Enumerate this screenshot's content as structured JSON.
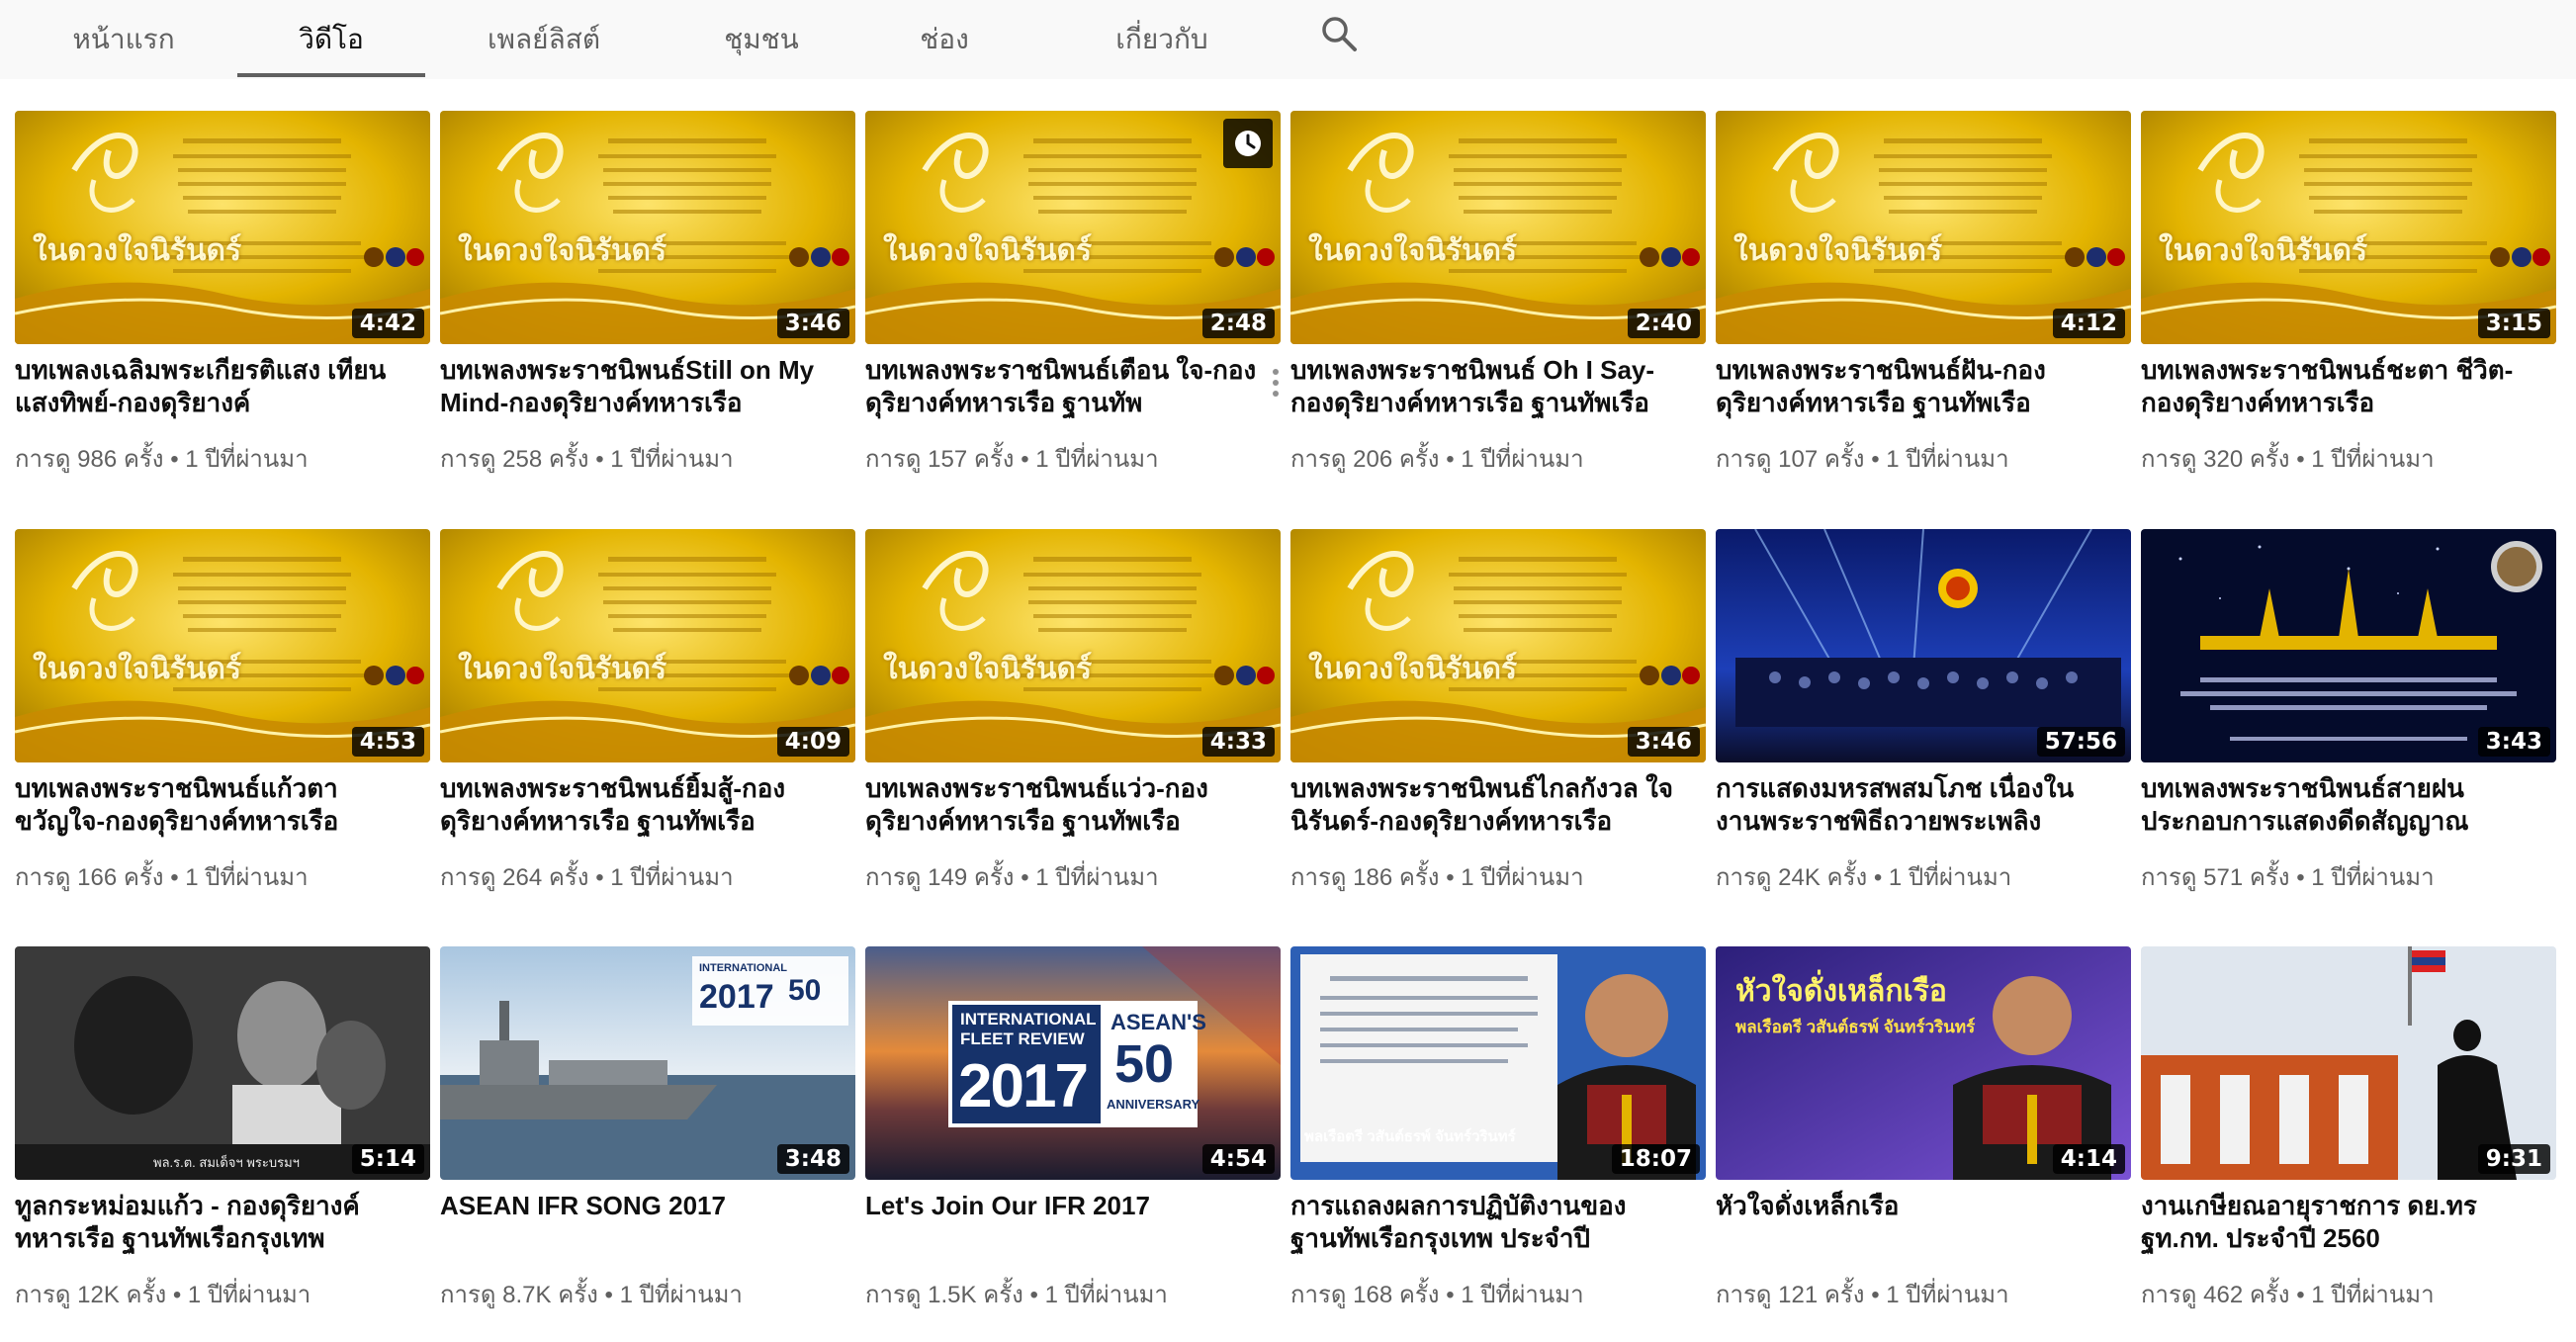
{
  "tabs": [
    {
      "label": "หน้าแรก"
    },
    {
      "label": "วิดีโอ"
    },
    {
      "label": "เพลย์ลิสต์"
    },
    {
      "label": "ชุมชน"
    },
    {
      "label": "ช่อง"
    },
    {
      "label": "เกี่ยวกับ"
    }
  ],
  "active_tab": "วิดีโอ",
  "search_icon": "search-icon",
  "videos": [
    {
      "title": "บทเพลงเฉลิมพระเกียรติแสง เทียนแสงทิพย์-กองดุริยางค์",
      "meta": "การดู 986 ครั้ง • 1 ปีที่ผ่านมา",
      "duration": "4:42",
      "thumb": "gold"
    },
    {
      "title": "บทเพลงพระราชนิพนธ์Still on My Mind-กองดุริยางค์ทหารเรือ",
      "meta": "การดู 258 ครั้ง • 1 ปีที่ผ่านมา",
      "duration": "3:46",
      "thumb": "gold"
    },
    {
      "title": "บทเพลงพระราชนิพนธ์เตือน ใจ-กองดุริยางค์ทหารเรือ ฐานทัพ",
      "meta": "การดู 157 ครั้ง • 1 ปีที่ผ่านมา",
      "duration": "2:48",
      "thumb": "gold",
      "watch_later": "clock-icon",
      "more": "more-vert-icon"
    },
    {
      "title": "บทเพลงพระราชนิพนธ์ Oh I Say-กองดุริยางค์ทหารเรือ ฐานทัพเรือ",
      "meta": "การดู 206 ครั้ง • 1 ปีที่ผ่านมา",
      "duration": "2:40",
      "thumb": "gold"
    },
    {
      "title": "บทเพลงพระราชนิพนธ์ฝัน-กอง ดุริยางค์ทหารเรือ ฐานทัพเรือ",
      "meta": "การดู 107 ครั้ง • 1 ปีที่ผ่านมา",
      "duration": "4:12",
      "thumb": "gold"
    },
    {
      "title": "บทเพลงพระราชนิพนธ์ชะตา ชีวิต-กองดุริยางค์ทหารเรือ",
      "meta": "การดู 320 ครั้ง • 1 ปีที่ผ่านมา",
      "duration": "3:15",
      "thumb": "gold"
    },
    {
      "title": "บทเพลงพระราชนิพนธ์แก้วตา ขวัญใจ-กองดุริยางค์ทหารเรือ",
      "meta": "การดู 166 ครั้ง • 1 ปีที่ผ่านมา",
      "duration": "4:53",
      "thumb": "gold"
    },
    {
      "title": "บทเพลงพระราชนิพนธ์ยิ้มสู้-กอง ดุริยางค์ทหารเรือ ฐานทัพเรือ",
      "meta": "การดู 264 ครั้ง • 1 ปีที่ผ่านมา",
      "duration": "4:09",
      "thumb": "gold"
    },
    {
      "title": "บทเพลงพระราชนิพนธ์แว่ว-กอง ดุริยางค์ทหารเรือ ฐานทัพเรือ",
      "meta": "การดู 149 ครั้ง • 1 ปีที่ผ่านมา",
      "duration": "4:33",
      "thumb": "gold"
    },
    {
      "title": "บทเพลงพระราชนิพนธ์ไกลกังวล ใจ นิรันดร์-กองดุริยางค์ทหารเรือ",
      "meta": "การดู 186 ครั้ง • 1 ปีที่ผ่านมา",
      "duration": "3:46",
      "thumb": "gold"
    },
    {
      "title": "การแสดงมหรสพสมโภช เนื่องใน งานพระราชพิธีถวายพระเพลิง",
      "meta": "การดู 24K ครั้ง • 1 ปีที่ผ่านมา",
      "duration": "57:56",
      "thumb": "concert"
    },
    {
      "title": "บทเพลงพระราชนิพนธ์สายฝน ประกอบการแสดงดีดสัญญาณ",
      "meta": "การดู 571 ครั้ง • 1 ปีที่ผ่านมา",
      "duration": "3:43",
      "thumb": "night"
    },
    {
      "title": "ทูลกระหม่อมแก้ว - กองดุริยางค์ ทหารเรือ ฐานทัพเรือกรุงเทพ",
      "meta": "การดู 12K ครั้ง • 1 ปีที่ผ่านมา",
      "duration": "5:14",
      "thumb": "bw"
    },
    {
      "title": "ASEAN IFR SONG 2017",
      "meta": "การดู 8.7K ครั้ง • 1 ปีที่ผ่านมา",
      "duration": "3:48",
      "thumb": "ship"
    },
    {
      "title": "Let's Join Our IFR 2017",
      "meta": "การดู 1.5K ครั้ง • 1 ปีที่ผ่านมา",
      "duration": "4:54",
      "thumb": "ifr"
    },
    {
      "title": "การแถลงผลการปฏิบัติงานของ ฐานทัพเรือกรุงเทพ ประจำปี",
      "meta": "การดู 168 ครั้ง • 1 ปีที่ผ่านมา",
      "duration": "18:07",
      "thumb": "report"
    },
    {
      "title": "หัวใจดั่งเหล็กเรือ",
      "meta": "การดู 121 ครั้ง • 1 ปีที่ผ่านมา",
      "duration": "4:14",
      "thumb": "purple"
    },
    {
      "title": "งานเกษียณอายุราชการ ดย.ทร ฐท.กท. ประจำปี 2560",
      "meta": "การดู 462 ครั้ง • 1 ปีที่ผ่านมา",
      "duration": "9:31",
      "thumb": "statue"
    }
  ],
  "thumb_text": {
    "gold_caption": "ในดวงใจนิรันดร์",
    "ifr_line1": "INTERNATIONAL",
    "ifr_line2": "FLEET REVIEW",
    "ifr_year": "2017",
    "asean_line1": "ASEAN'S",
    "asean_num": "50",
    "asean_line2": "ANNIVERSARY",
    "purple_caption": "หัวใจดั่งเหล็กเรือ",
    "purple_sub": "พลเรือตรี วสันต์ธรพ์ จันทร์วรินทร์",
    "report_name": "พลเรือตรี วสันต์ธรพ์ จันทร์วรินทร์",
    "bw_caption": "พล.ร.ต. สมเด็จฯ พระบรมฯ"
  },
  "colors": {
    "gold": "#e3b400",
    "gold_light": "#fde36a",
    "gold_dark": "#9c7400",
    "navy": "#0b1d58",
    "purple": "#4c3aa8"
  }
}
